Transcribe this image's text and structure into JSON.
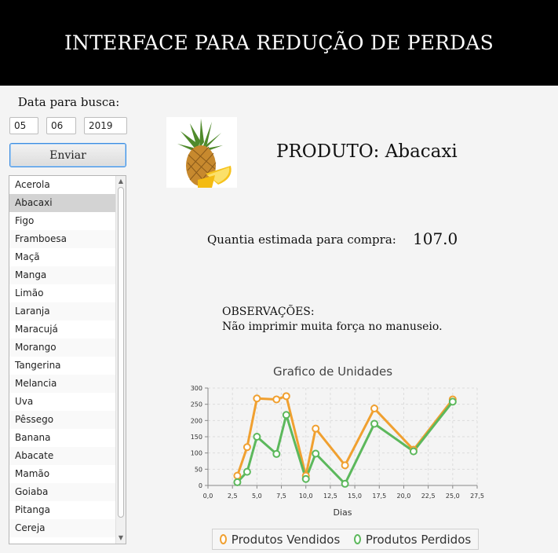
{
  "header": {
    "title": "INTERFACE PARA REDUÇÃO DE PERDAS"
  },
  "search": {
    "date_label": "Data para busca:",
    "day": "05",
    "month": "06",
    "year": "2019",
    "send_label": "Enviar"
  },
  "fruits": {
    "selected": "Abacaxi",
    "items": [
      "Acerola",
      "Abacaxi",
      "Figo",
      "Framboesa",
      "Maçã",
      "Manga",
      "Limão",
      "Laranja",
      "Maracujá",
      "Morango",
      "Tangerina",
      "Melancia",
      "Uva",
      "Pêssego",
      "Banana",
      "Abacate",
      "Mamão",
      "Goiaba",
      "Pitanga",
      "Cereja"
    ]
  },
  "product": {
    "title": "PRODUTO: Abacaxi",
    "image_icon": "pineapple-icon",
    "qty_label": "Quantia estimada para compra:",
    "qty_value": "107.0",
    "obs_title": "OBSERVAÇÕES:",
    "obs_text": "Não imprimir muita força no manuseio."
  },
  "colors": {
    "vendidos": "#f0a030",
    "perdidos": "#5cb85c",
    "header_bg": "#000000"
  },
  "chart_data": {
    "type": "line",
    "title": "Grafico de Unidades",
    "xlabel": "Dias",
    "ylabel": "",
    "xlim": [
      0,
      27.5
    ],
    "ylim": [
      0,
      300
    ],
    "x_ticks": [
      "0,0",
      "2,5",
      "5,0",
      "7,5",
      "10,0",
      "12,5",
      "15,0",
      "17,5",
      "20,0",
      "22,5",
      "25,0",
      "27,5"
    ],
    "y_ticks": [
      "0",
      "50",
      "100",
      "150",
      "200",
      "250",
      "300"
    ],
    "grid": true,
    "legend_position": "bottom",
    "series": [
      {
        "name": "Produtos Vendidos",
        "x": [
          3,
          4,
          5,
          7,
          8,
          10,
          11,
          14,
          17,
          21,
          25
        ],
        "y": [
          30,
          118,
          268,
          265,
          275,
          30,
          175,
          62,
          237,
          110,
          265
        ]
      },
      {
        "name": "Produtos Perdidos",
        "x": [
          3,
          4,
          5,
          7,
          8,
          10,
          11,
          14,
          17,
          21,
          25
        ],
        "y": [
          10,
          42,
          150,
          97,
          217,
          20,
          98,
          5,
          190,
          105,
          258
        ]
      }
    ]
  }
}
